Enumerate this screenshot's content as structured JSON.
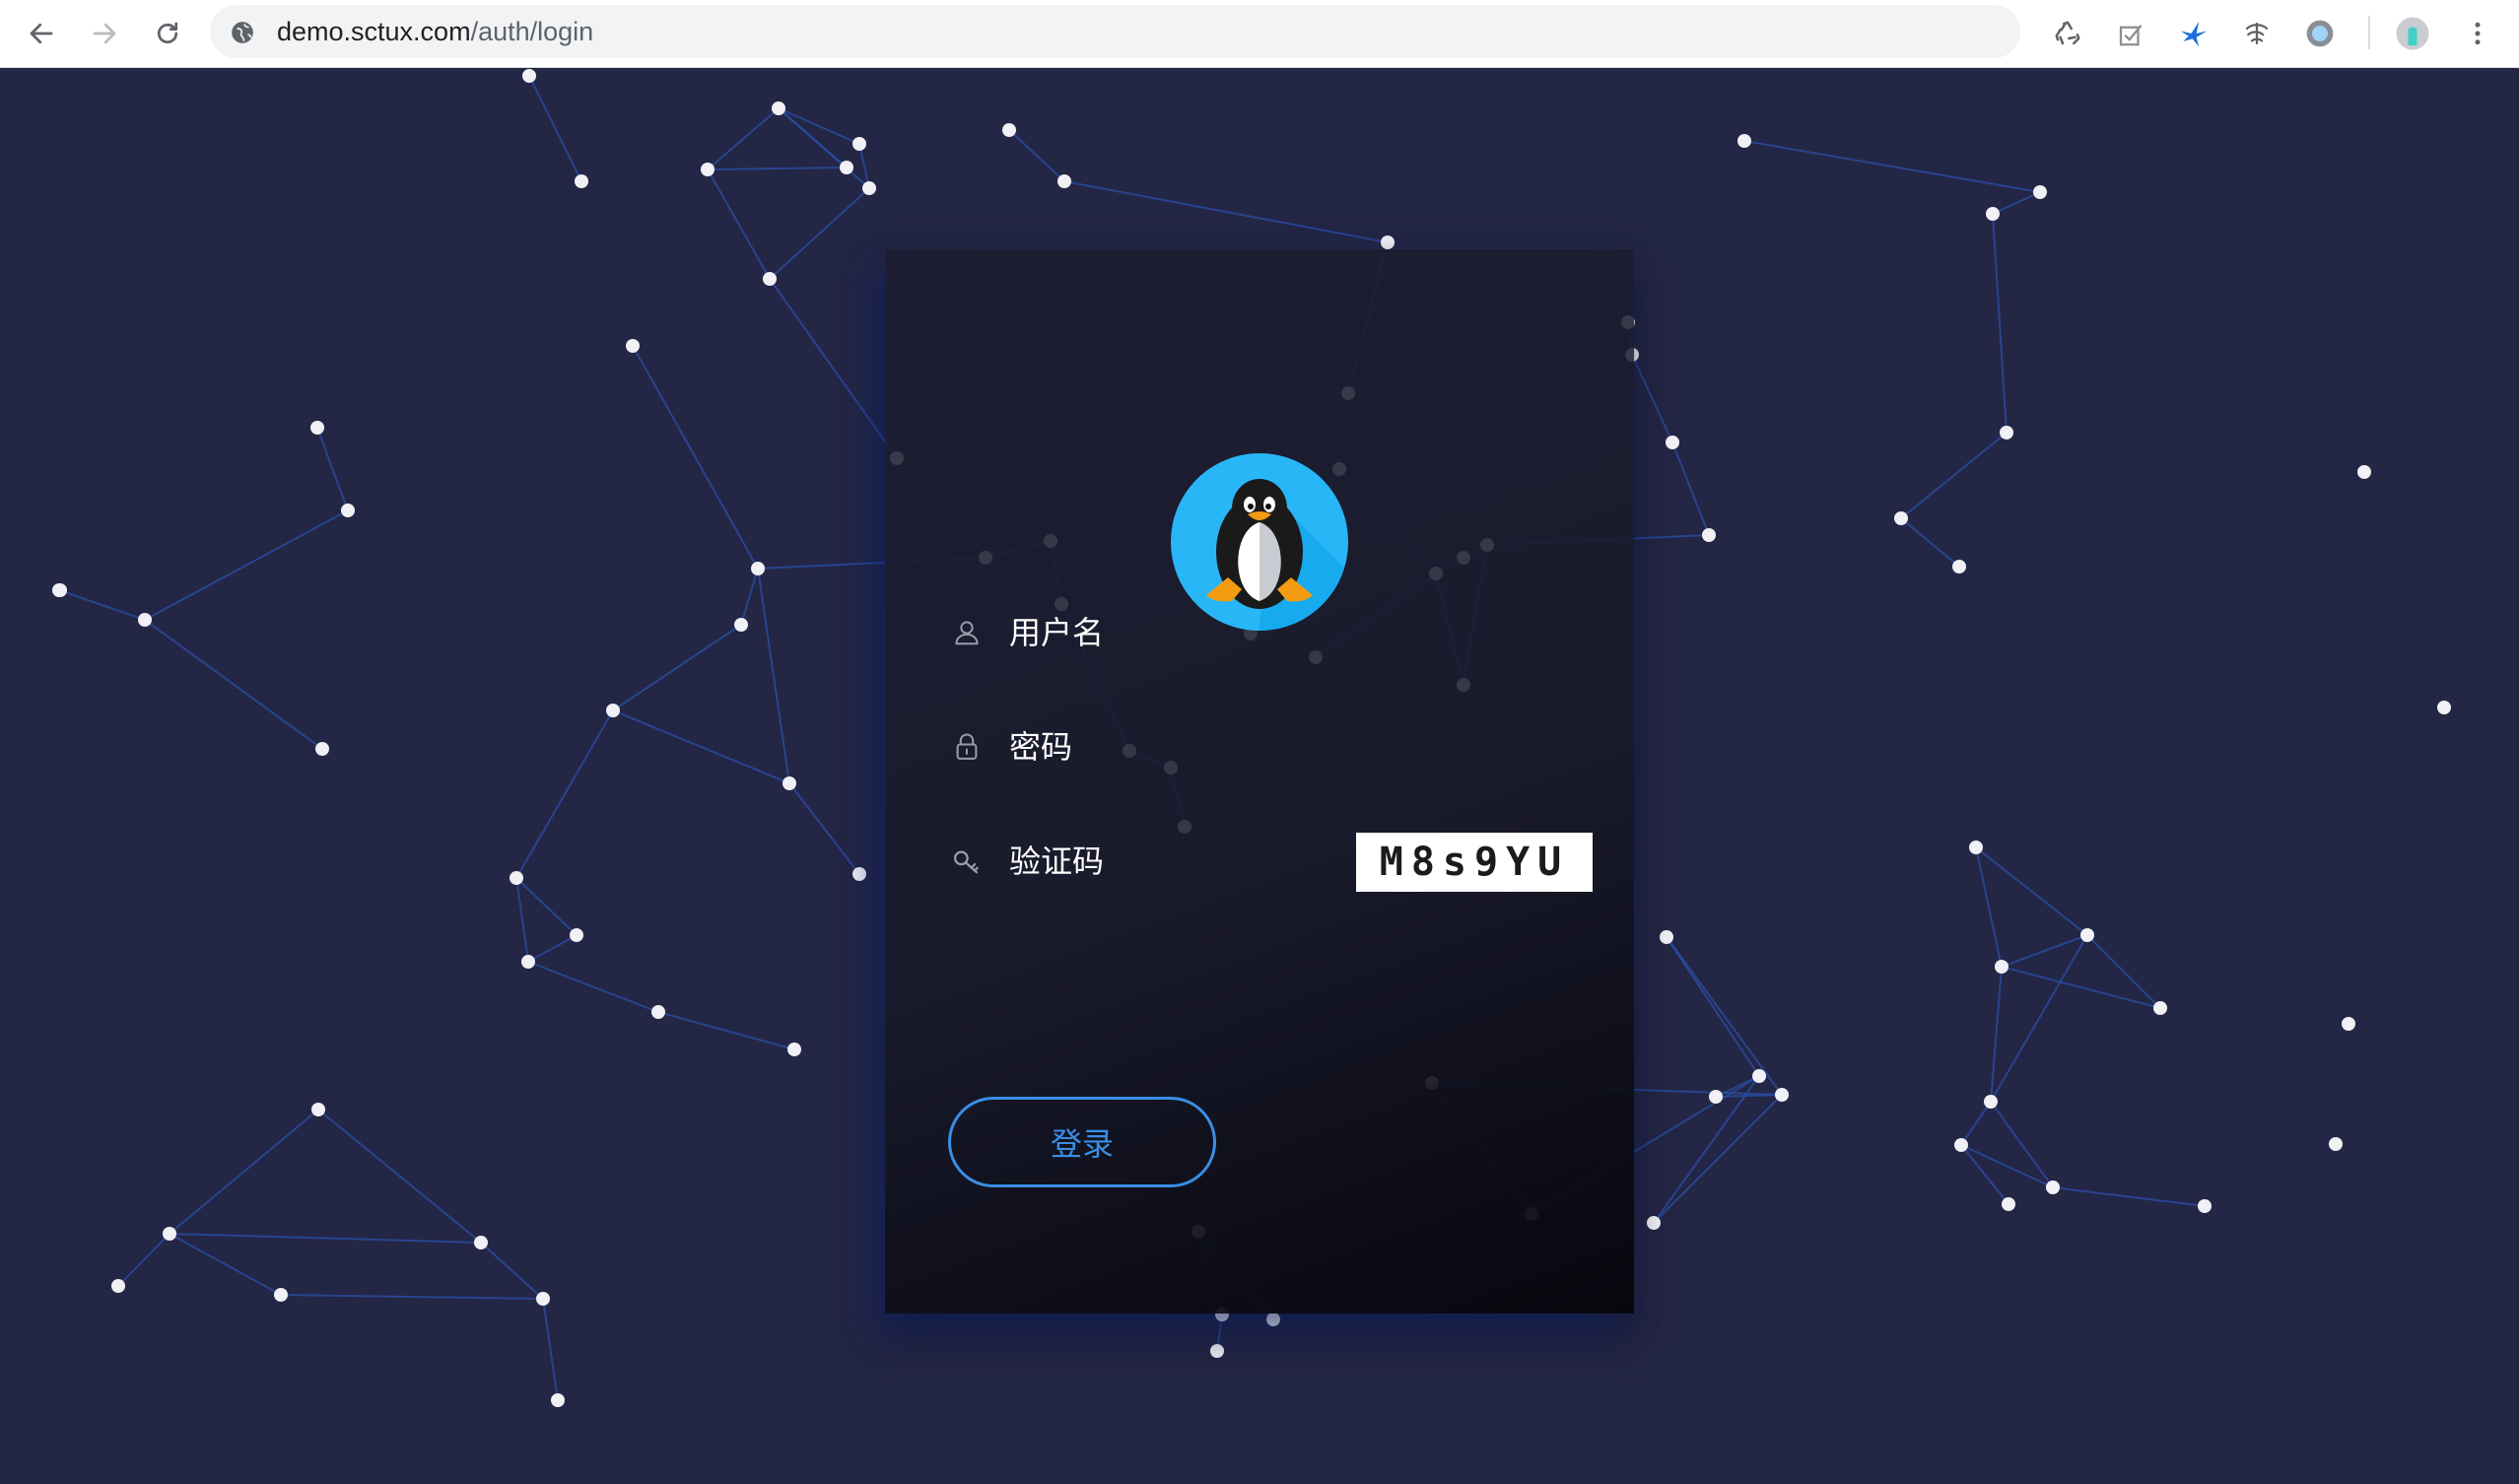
{
  "browser": {
    "url_host": "demo.sctux.com",
    "url_path": "/auth/login",
    "extensions": [
      "recycle-icon",
      "clipboard-icon",
      "bird-icon",
      "swirl-icon",
      "circle-extension-icon"
    ]
  },
  "login": {
    "avatar_icon": "tux-penguin-icon",
    "username_placeholder": "用户名",
    "password_placeholder": "密码",
    "captcha_placeholder": "验证码",
    "captcha_text": "M8s9YU",
    "submit_label": "登录"
  },
  "colors": {
    "background": "#242645",
    "accent": "#3a8ee6",
    "avatar_bg": "#29b6f6",
    "network_line": "#2a4fa8",
    "node": "#f0f0f5"
  }
}
